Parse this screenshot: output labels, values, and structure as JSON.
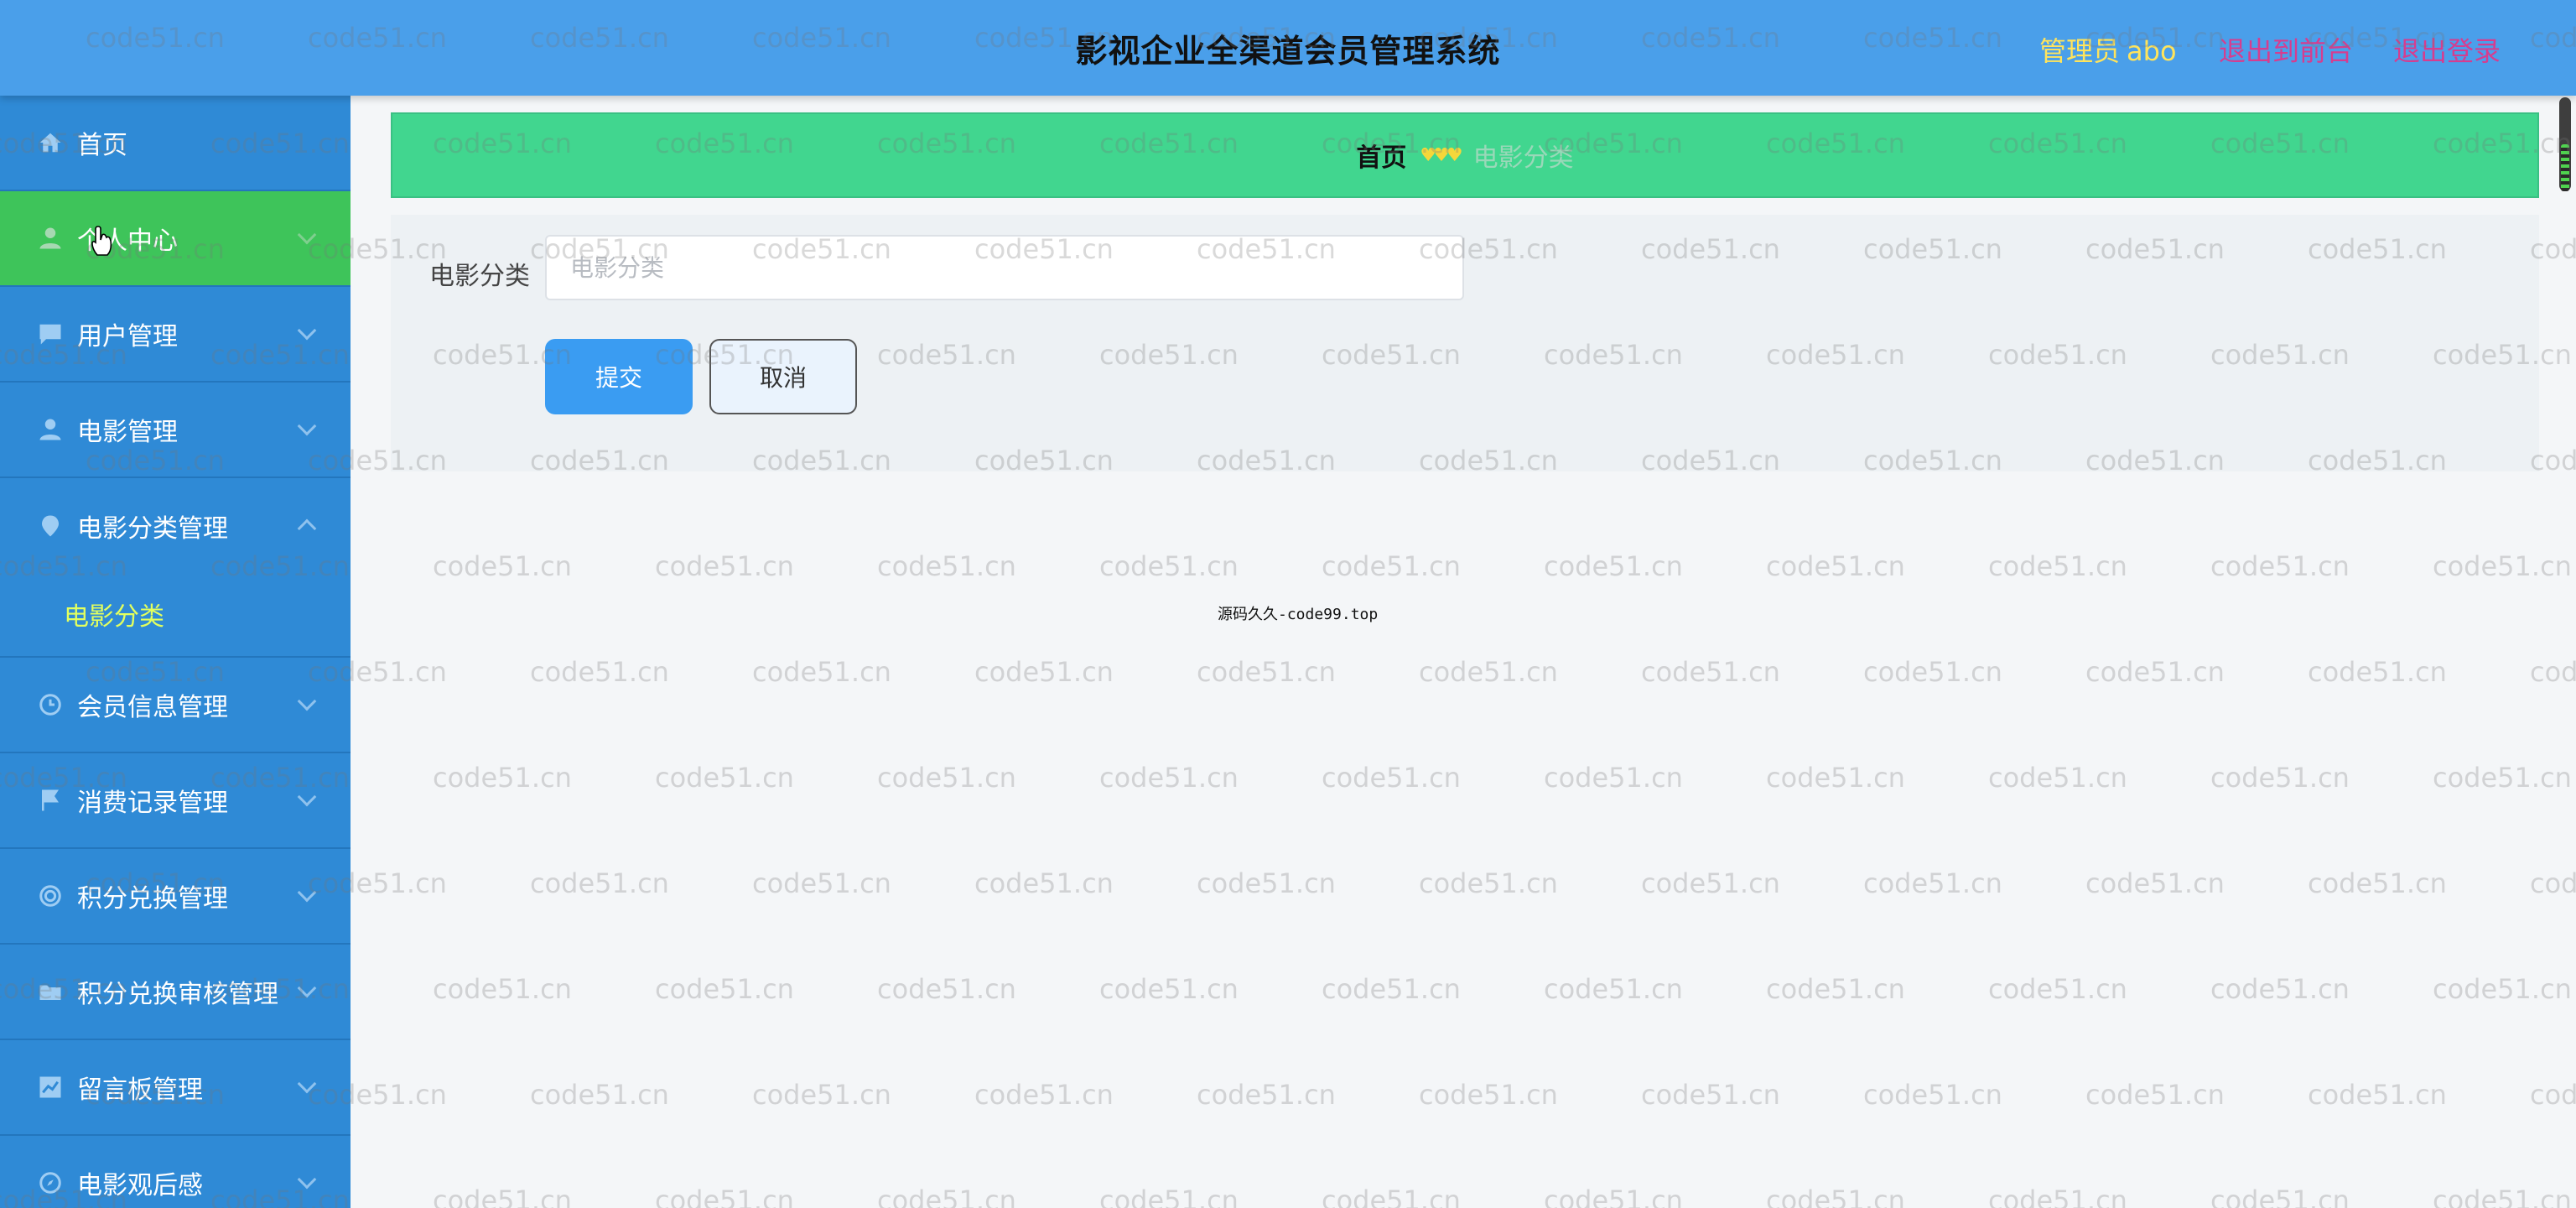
{
  "header": {
    "title": "影视企业全渠道会员管理系统",
    "role_label": "管理员",
    "username": "abo",
    "front_link": "退出到前台",
    "logout_link": "退出登录"
  },
  "sidebar": {
    "items": [
      {
        "label": "首页",
        "icon": "home-icon",
        "active": false
      },
      {
        "label": "个人中心",
        "icon": "user-icon",
        "active": true
      },
      {
        "label": "用户管理",
        "icon": "chat-icon",
        "active": false
      },
      {
        "label": "电影管理",
        "icon": "user-icon",
        "active": false
      },
      {
        "label": "电影分类管理",
        "icon": "location-pin-icon",
        "active": false,
        "expanded": true
      },
      {
        "label": "会员信息管理",
        "icon": "clock-icon",
        "active": false
      },
      {
        "label": "消费记录管理",
        "icon": "flag-icon",
        "active": false
      },
      {
        "label": "积分兑换管理",
        "icon": "target-icon",
        "active": false
      },
      {
        "label": "积分兑换审核管理",
        "icon": "folder-icon",
        "active": false
      },
      {
        "label": "留言板管理",
        "icon": "chart-icon",
        "active": false
      },
      {
        "label": "电影观后感",
        "icon": "compass-icon",
        "active": false
      }
    ],
    "submenu_label": "电影分类"
  },
  "breadcrumb": {
    "home": "首页",
    "separator": "♥♥♥",
    "current": "电影分类"
  },
  "form": {
    "label": "电影分类",
    "placeholder": "电影分类",
    "value": "",
    "submit_label": "提交",
    "cancel_label": "取消"
  },
  "footer_note": "源码久久-code99.top",
  "watermark": "code51.cn",
  "colors": {
    "header_bg": "#4a9fea",
    "sidebar_bg": "#2f8ad6",
    "active_item": "#3ec45a",
    "breadcrumb_bg": "#41d68f",
    "submit_button": "#3a9cf2",
    "admin_text": "#ffe45c",
    "header_links": "#d63d8f",
    "submenu_text": "#e2ff5f"
  }
}
